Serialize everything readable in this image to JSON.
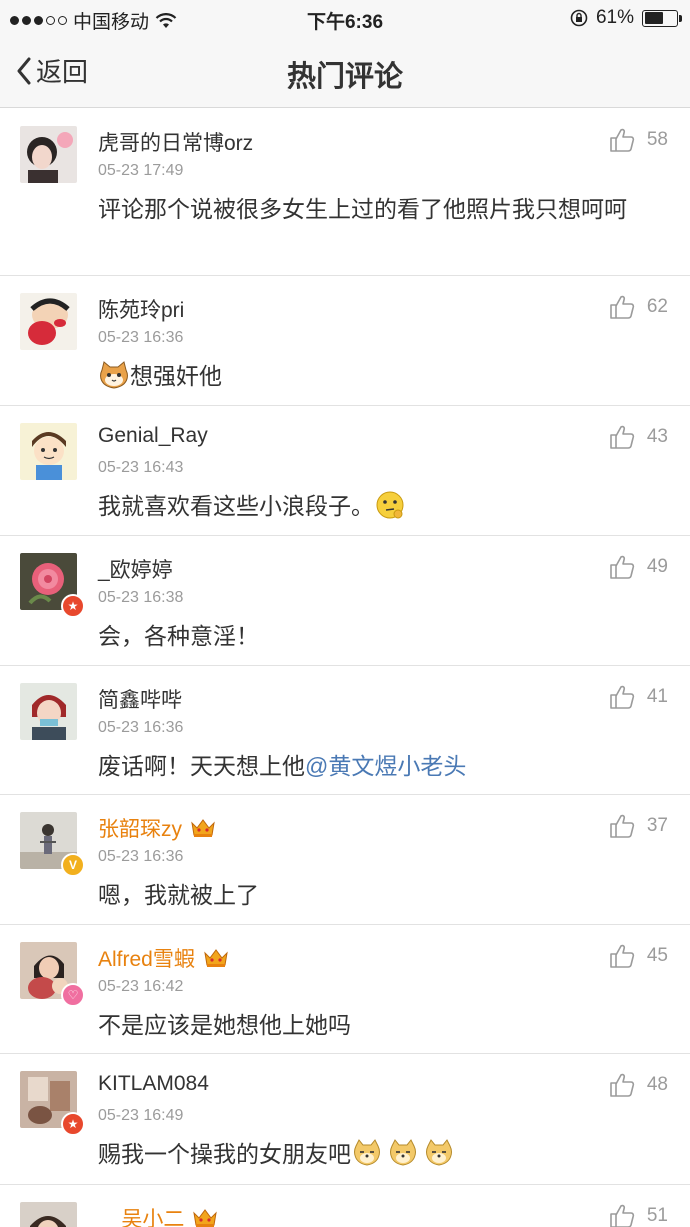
{
  "status_bar": {
    "carrier": "中国移动",
    "time": "下午6:36",
    "battery": "61%",
    "battery_level": 0.61,
    "signal_bars": 3
  },
  "nav": {
    "back_label": "返回",
    "title": "热门评论"
  },
  "colors": {
    "vip_name": "#e8820f",
    "mention": "#4a79b4",
    "verified_orange": "#f2b01e",
    "star_badge": "#e8482d",
    "pink_badge": "#f06fa0"
  },
  "comments": [
    {
      "name": "虎哥的日常博orz",
      "time": "05-23 17:49",
      "text": "评论那个说被很多女生上过的看了他照片我只想呵呵",
      "likes": "58"
    },
    {
      "name": "陈苑玲pri",
      "time": "05-23 16:36",
      "text": "想强奸他",
      "likes": "62"
    },
    {
      "name": "Genial_Ray",
      "time": "05-23 16:43",
      "text": "我就喜欢看这些小浪段子。",
      "likes": "43"
    },
    {
      "name": "_欧婷婷",
      "time": "05-23 16:38",
      "text": "会，各种意淫！",
      "likes": "49",
      "badge": "star-badge"
    },
    {
      "name": "简鑫哔哔",
      "time": "05-23 16:36",
      "text": "废话啊！天天想上他",
      "mention": "@黄文煜小老头",
      "likes": "41"
    },
    {
      "name": "张韶琛zy",
      "time": "05-23 16:36",
      "text": "嗯，我就被上了",
      "likes": "37",
      "vip": true,
      "badge": "verified-v-badge"
    },
    {
      "name": "Alfred雪蝦",
      "time": "05-23 16:42",
      "text": "不是应该是她想他上她吗",
      "likes": "45",
      "vip": true,
      "badge": "pink-badge"
    },
    {
      "name": "KITLAM084",
      "time": "05-23 16:49",
      "text": "赐我一个操我的女朋友吧",
      "likes": "48",
      "badge": "star-badge"
    },
    {
      "name": "__吴小二",
      "likes": "51",
      "vip": true
    }
  ]
}
